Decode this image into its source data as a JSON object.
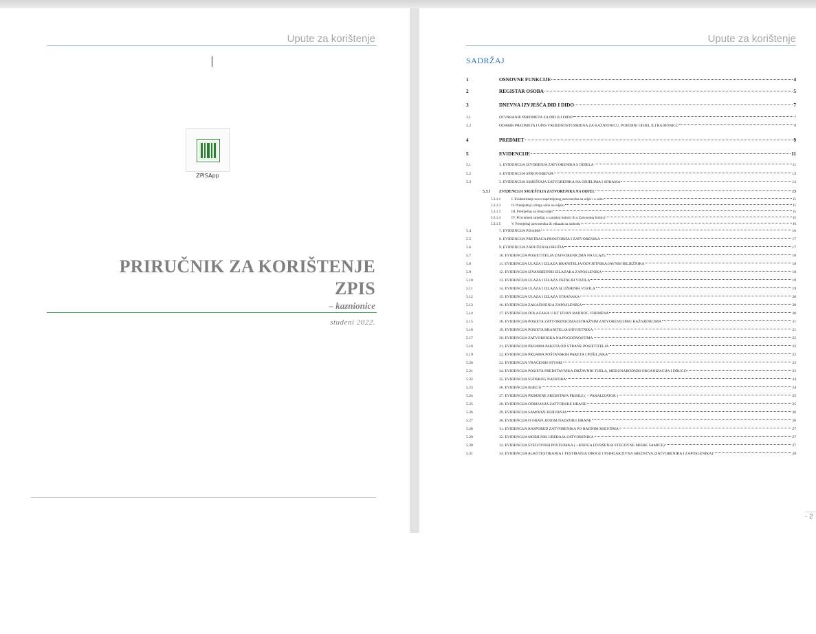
{
  "header_text": "Upute za korištenje",
  "cover": {
    "app_label": "ZPISApp",
    "title_line1": "PRIRUČNIK ZA KORIŠTENJE",
    "title_line2": "ZPIS",
    "subtitle": "– kaznionice",
    "date": "studeni 2022."
  },
  "toc": {
    "title": "SADRŽAJ",
    "rows": [
      {
        "level": 1,
        "num": "1",
        "text": "OSNOVNE FUNKCIJE",
        "page": "4"
      },
      {
        "level": 1,
        "num": "2",
        "text": "REGISTAR OSOBA",
        "page": "5"
      },
      {
        "level": 1,
        "num": "3",
        "text": "DNEVNA IZVJEŠĆA DID I DIDO",
        "page": "7"
      },
      {
        "level": 2,
        "num": "3.1",
        "text": "OTVARANJE PREDMETA ZA DID ILI DIDO",
        "page": "7"
      },
      {
        "level": 2,
        "num": "3.2",
        "text": "ODABIR PREDMETA I UPIS VRIJEDNOSTI/SMJENA ZA KAZNIONICU, POJEDINI ODJEL ILI RADIONICU",
        "page": "8"
      },
      {
        "level": 1,
        "num": "4",
        "text": "PREDMET",
        "page": "9"
      },
      {
        "level": 1,
        "num": "5",
        "text": "EVIDENCIJE",
        "page": "11"
      },
      {
        "level": 2,
        "num": "5.1",
        "text": "3. EVIDENCIJA IZVOĐENJA ZATVORENIKA S ODJELA",
        "page": "11"
      },
      {
        "level": 2,
        "num": "5.2",
        "text": "4. EVIDENCIJA SPROVOĐENJA",
        "page": "13"
      },
      {
        "level": 2,
        "num": "5.3",
        "text": "5. EVIDENCIJA SMJEŠTAJA ZATVORENIKA NA ODJELIMA I SOBAMA",
        "page": "13"
      },
      {
        "level": 3,
        "num": "5.3.1",
        "text": "EVIDENCIJA SMJEŠTAJA ZATVORENIKA NA ODJEL",
        "page": "15"
      },
      {
        "level": 4,
        "num": "5.3.1.1",
        "text": "I. Evidentiranje novo zaprimljenog zatvorenika na odjel i u sobu",
        "page": "15"
      },
      {
        "level": 4,
        "num": "5.3.1.2",
        "text": "II. Premještaj u drugu sobu na odjelu",
        "page": "15"
      },
      {
        "level": 4,
        "num": "5.3.1.3",
        "text": "III. Premještaj na drugi odjel",
        "page": "15"
      },
      {
        "level": 4,
        "num": "5.3.1.4",
        "text": "IV. Privremeni smještaj u vanjskoj bolnici ili u Zatvorskoj bolnici",
        "page": "15"
      },
      {
        "level": 4,
        "num": "5.3.1.5",
        "text": "V. Premještaj zatvorenika ili odlazak na slobodu",
        "page": "16"
      },
      {
        "level": 2,
        "num": "5.4",
        "text": "7. EVIDENCIJA PISAMA",
        "page": "16"
      },
      {
        "level": 2,
        "num": "5.5",
        "text": "8. EVIDENCIJA PRETRAGA PROSTORIJA I ZATVORENIKA",
        "page": "17"
      },
      {
        "level": 2,
        "num": "5.6",
        "text": "9. EVIDENCIJA ZADUŽENJA ORUŽJA",
        "page": "17"
      },
      {
        "level": 2,
        "num": "5.7",
        "text": "10. EVIDENCIJA POSJETITELJA ZATVORENICIMA NA ULAZU",
        "page": "18"
      },
      {
        "level": 2,
        "num": "5.8",
        "text": "11. EVIDENCIJA ULAZA I IZLAZA BRANITELJA/ODVJETNIKA/JAVNIH BILJEŽNIKA",
        "page": "18"
      },
      {
        "level": 2,
        "num": "5.9",
        "text": "12. EVIDENCIJA IZVANREDNIH IZLAZAKA ZAPOSLENIKA",
        "page": "18"
      },
      {
        "level": 2,
        "num": "5.10",
        "text": "13. EVIDENCIJA ULAZA I IZLAZA OSTALIH VOZILA",
        "page": "19"
      },
      {
        "level": 2,
        "num": "5.11",
        "text": "14. EVIDENCIJA ULAZA I IZLAZA SLUŽBENIH VOZILA",
        "page": "19"
      },
      {
        "level": 2,
        "num": "5.12",
        "text": "15. EVIDENCIJA ULAZA I IZLAZA STRANAKA",
        "page": "20"
      },
      {
        "level": 2,
        "num": "5.13",
        "text": "16. EVIDENCIJA ZAKAŠNJENJA ZAPOSLENIKA",
        "page": "20"
      },
      {
        "level": 2,
        "num": "5.14",
        "text": "17. EVIDENCIJA DOLAZAKA U KT IZVAN RADNOG VREMENA",
        "page": "20"
      },
      {
        "level": 2,
        "num": "5.15",
        "text": "18. EVIDENCIJA POSJETA ZATVORENICIMA/ISTRAŽNIM ZATVORENICIMA/ KAŽNJENICIMA",
        "page": "21"
      },
      {
        "level": 2,
        "num": "5.16",
        "text": "19. EVIDENCIJA POSJETA BRANITELJA/ODVJETNIKA",
        "page": "21"
      },
      {
        "level": 2,
        "num": "5.17",
        "text": "20. EVIDENCIJA ZATVORENIKA NA POGODNOSTIMA",
        "page": "22"
      },
      {
        "level": 2,
        "num": "5.18",
        "text": "21. EVIDENCIJA PRIJAMA PAKETA OD STRANE POSJETITELJA",
        "page": "22"
      },
      {
        "level": 2,
        "num": "5.19",
        "text": "22. EVIDENCIJA PRIJAMA POŠTANSKIH PAKETA I POŠILJAKA",
        "page": "23"
      },
      {
        "level": 2,
        "num": "5.20",
        "text": "23. EVIDENCIJA VRAĆENIH STVARI",
        "page": "23"
      },
      {
        "level": 2,
        "num": "5.21",
        "text": "24. EVIDENCIJA POSJETA PREDSTAVNIKA DRŽAVNIH TIJELA, MEĐUNARODNIH ORGANIZACIJA I DRUGO",
        "page": "23"
      },
      {
        "level": 2,
        "num": "5.22",
        "text": "25. EVIDENCIJA SUDSKOG NADZORA",
        "page": "24"
      },
      {
        "level": 2,
        "num": "5.23",
        "text": "26. EVIDENCIJA BIJEGA",
        "page": "24"
      },
      {
        "level": 2,
        "num": "5.24",
        "text": "27. EVIDENCIJA PRIMJENE SREDSTAVA PRISILE ( + PARALIZATOR )",
        "page": "25"
      },
      {
        "level": 2,
        "num": "5.25",
        "text": "28. EVIDENCIJA ODBIJANJA ZATVORSKE HRANE",
        "page": "25"
      },
      {
        "level": 2,
        "num": "5.26",
        "text": "29. EVIDENCIJA SAMOOZLJEĐIVANJA",
        "page": "26"
      },
      {
        "level": 2,
        "num": "5.27",
        "text": "30. EVIDENCIJA O OBAVLJENOM NADZORU HRANE",
        "page": "26"
      },
      {
        "level": 2,
        "num": "5.28",
        "text": "31. EVIDENCIJA RASPORED ZATVORENIKA PO RADNIM MJESTIMA",
        "page": "27"
      },
      {
        "level": 2,
        "num": "5.29",
        "text": "32. EVIDENCIJA MOBILNIH UREĐAJA ZATVORENIKA",
        "page": "27"
      },
      {
        "level": 2,
        "num": "5.30",
        "text": "33. EVIDENCIJA STEGOVNIH POSTUPAKA ( +KNJIGA IZVRŠENJA STEGOVNE MJERE SAMICE)",
        "page": "27"
      },
      {
        "level": 2,
        "num": "5.31",
        "text": "34. EVIDENCIJA ALKOTESTIRANJA I TESTIRANJA DROGE I PSIHOAKTIVNA SREDSTVA (ZATVORENIKA I ZAPOSLENIKA)",
        "page": "28"
      }
    ]
  },
  "page_number": "- 2"
}
